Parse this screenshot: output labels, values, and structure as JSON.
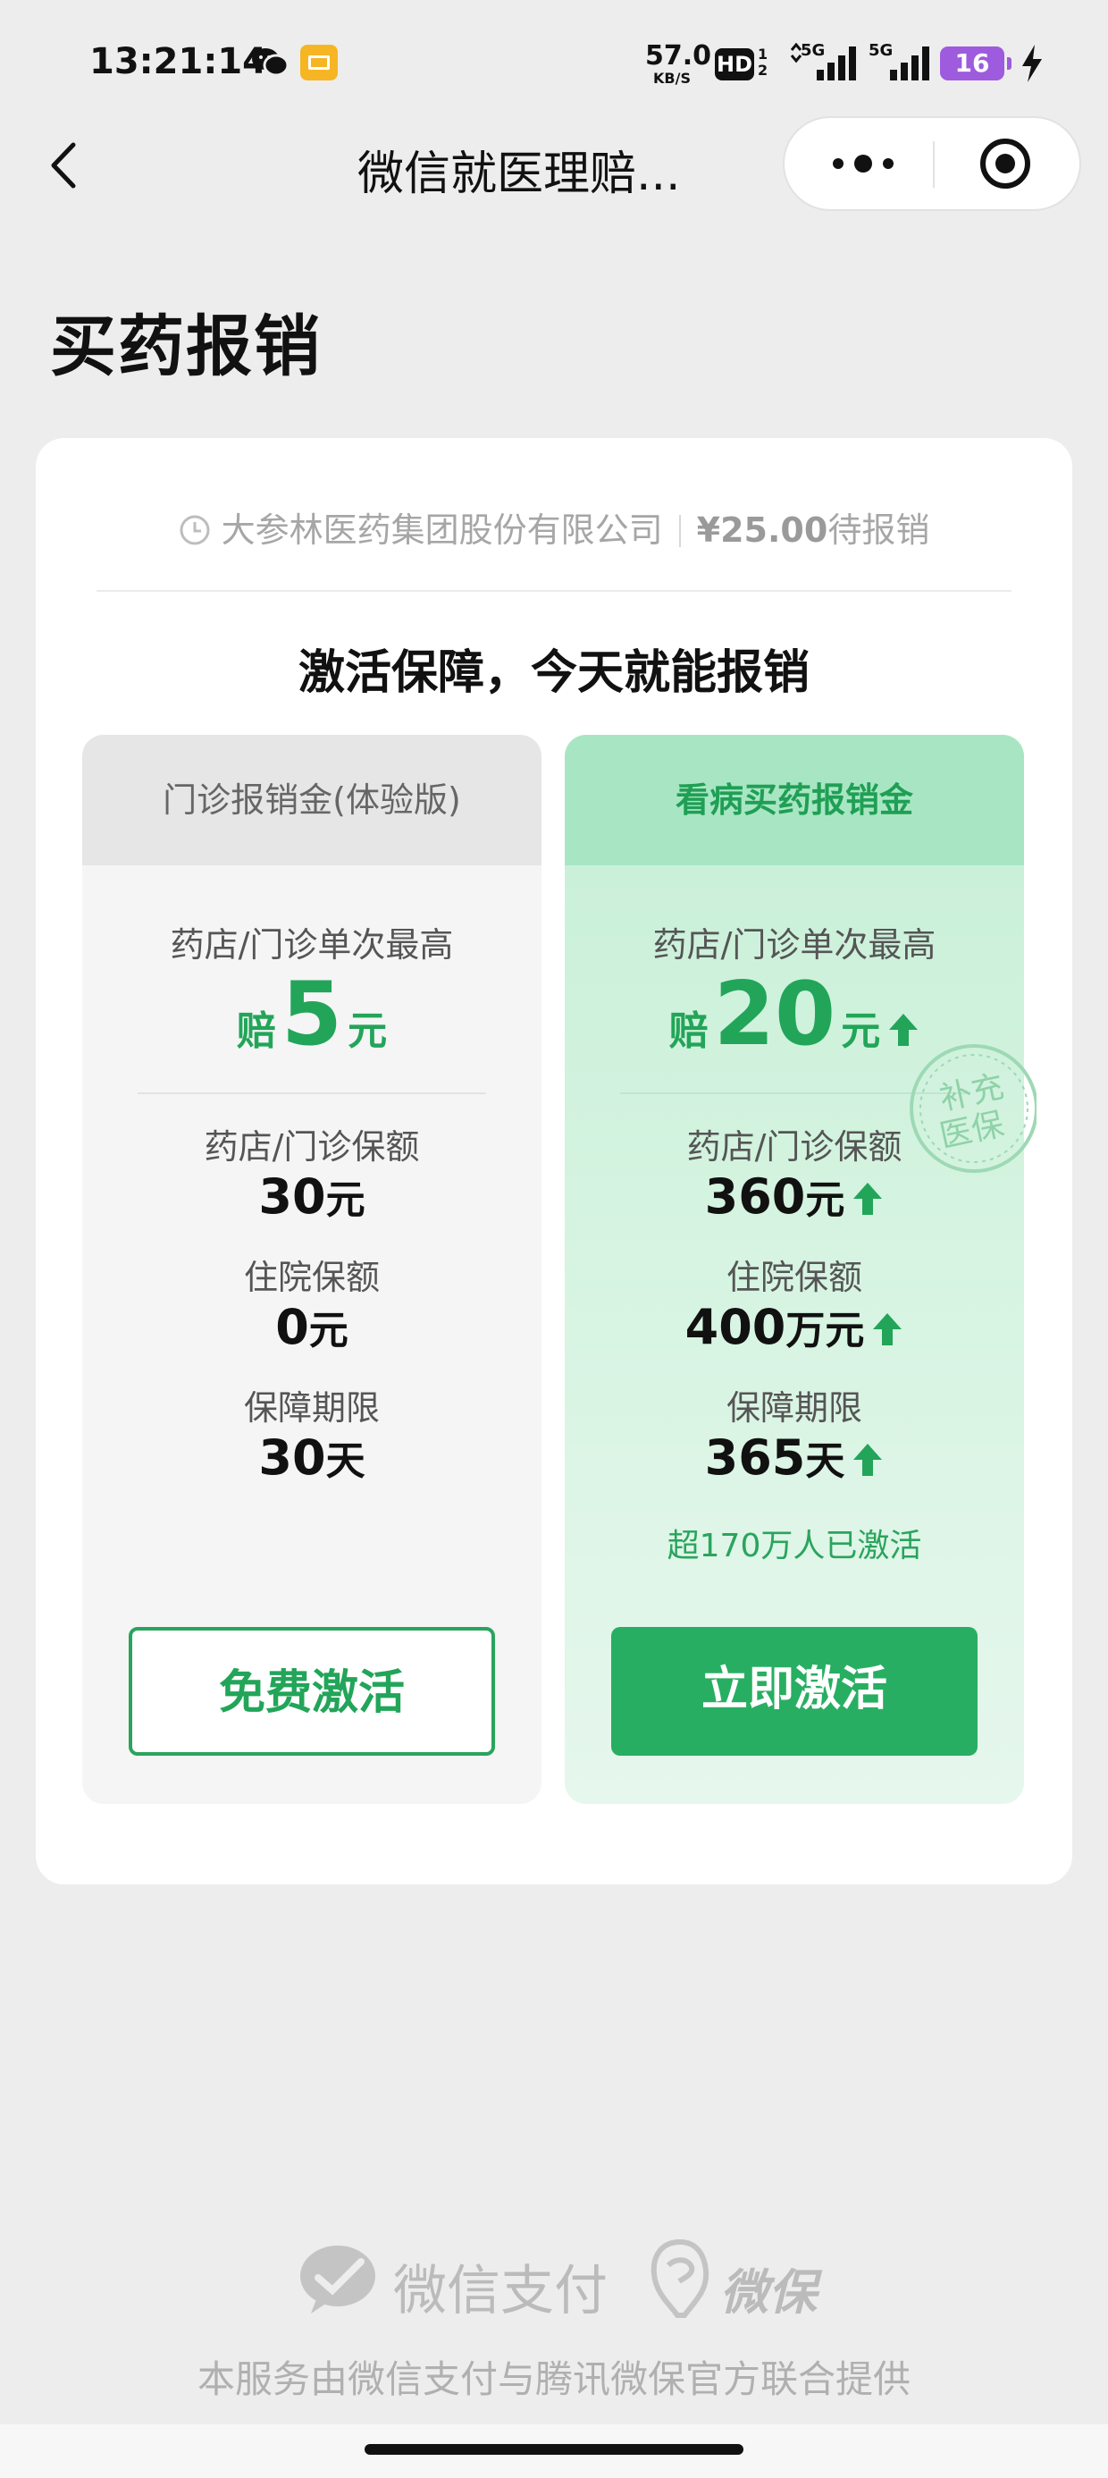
{
  "status_bar": {
    "time": "13:21:14",
    "speed_value": "57.0",
    "speed_unit": "KB/S",
    "hd_label": "HD",
    "hd_sub": "1\n2",
    "net_label_1": "5G",
    "net_label_2": "5G",
    "battery": "16",
    "icons": [
      "wechat-icon",
      "mail-icon",
      "signal-icon",
      "signal-icon",
      "charging-icon"
    ]
  },
  "nav": {
    "title": "微信就医理赔...",
    "icons": [
      "back-icon",
      "more-icon",
      "close-target-icon"
    ]
  },
  "page_title": "买药报销",
  "card": {
    "merchant": "大参林医药集团股份有限公司",
    "amount": "¥25.00",
    "amount_suffix": "待报销",
    "headline": "激活保障，今天就能报销"
  },
  "plans": [
    {
      "name": "门诊报销金(体验版)",
      "per_visit_label": "药店/门诊单次最高",
      "per_visit_prefix": "赔",
      "per_visit_value": "5",
      "per_visit_unit": "元",
      "rows": [
        {
          "label": "药店/门诊保额",
          "value": "30",
          "unit": "元"
        },
        {
          "label": "住院保额",
          "value": "0",
          "unit": "元"
        },
        {
          "label": "保障期限",
          "value": "30",
          "unit": "天"
        }
      ],
      "button": "免费激活"
    },
    {
      "name": "看病买药报销金",
      "per_visit_label": "药店/门诊单次最高",
      "per_visit_prefix": "赔",
      "per_visit_value": "20",
      "per_visit_unit": "元",
      "rows": [
        {
          "label": "药店/门诊保额",
          "value": "360",
          "unit": "元"
        },
        {
          "label": "住院保额",
          "value": "400",
          "unit": "万元"
        },
        {
          "label": "保障期限",
          "value": "365",
          "unit": "天"
        }
      ],
      "activated_note": "超170万人已激活",
      "stamp_text": "补充医保",
      "button": "立即激活"
    }
  ],
  "footer": {
    "wxpay": "微信支付",
    "weibao": "微保",
    "note": "本服务由微信支付与腾讯微保官方联合提供"
  },
  "colors": {
    "accent_green": "#22A559",
    "button_green": "#28AE62",
    "battery_purple": "#9E5BDE",
    "page_bg": "#EDEDED"
  }
}
